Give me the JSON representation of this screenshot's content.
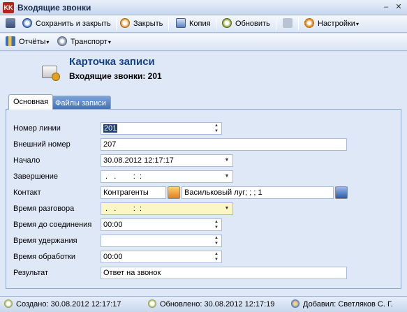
{
  "window": {
    "app_icon_text": "KK",
    "title": "Входящие звонки",
    "min_glyph": "–",
    "close_glyph": "✕"
  },
  "toolbar": {
    "save_close": "Сохранить и закрыть",
    "close": "Закрыть",
    "copy": "Копия",
    "refresh": "Обновить",
    "settings": "Настройки",
    "caret": "▾"
  },
  "toolbar2": {
    "reports": "Отчёты",
    "transport": "Транспорт",
    "caret": "▾"
  },
  "header": {
    "title": "Карточка записи",
    "subtitle": "Входящие звонки: 201"
  },
  "tabs": [
    {
      "label": "Основная",
      "active": true
    },
    {
      "label": "Файлы записи",
      "active": false
    }
  ],
  "form": {
    "line_number": {
      "label": "Номер линии",
      "value": "201"
    },
    "external_number": {
      "label": "Внешний номер",
      "value": "207"
    },
    "start": {
      "label": "Начало",
      "value": "30.08.2012 12:17:17"
    },
    "end": {
      "label": "Завершение",
      "value": " .   .        :  :"
    },
    "contact": {
      "label": "Контакт",
      "type_value": "Контрагенты",
      "name_value": "Васильковый луг; ; ; 1"
    },
    "talk_time": {
      "label": "Время разговора",
      "value": " .   .        :  :"
    },
    "time_to_connect": {
      "label": "Время до соединения",
      "value": "00:00"
    },
    "hold_time": {
      "label": "Время удержания",
      "value": ""
    },
    "processing_time": {
      "label": "Время обработки",
      "value": "00:00"
    },
    "result": {
      "label": "Результат",
      "value": "Ответ на звонок"
    }
  },
  "glyphs": {
    "spin_up": "▲",
    "spin_down": "▼",
    "dropdown": "▼"
  },
  "status": {
    "created": "Создано: 30.08.2012 12:17:17",
    "updated": "Обновлено: 30.08.2012 12:17:19",
    "added_by": "Добавил: Светляков С. Г."
  },
  "colors": {
    "accent": "#15428b",
    "highlight_field": "#fbf7c4",
    "tab_inactive": "#3e6eb6"
  }
}
